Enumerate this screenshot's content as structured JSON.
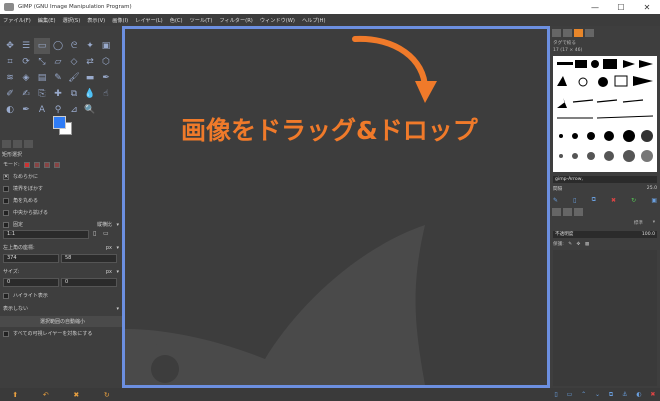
{
  "window": {
    "title": "GIMP (GNU Image Manipulation Program)",
    "minimize": "—",
    "maximize": "☐",
    "close": "✕"
  },
  "menu": [
    "ファイル(F)",
    "編集(E)",
    "選択(S)",
    "表示(V)",
    "画像(I)",
    "レイヤー(L)",
    "色(C)",
    "ツール(T)",
    "フィルター(R)",
    "ウィンドウ(W)",
    "ヘルプ(H)"
  ],
  "tool_options": {
    "title": "矩形選択",
    "mode_label": "モード:",
    "antialias": "なめらかに",
    "feather": "境界をぼかす",
    "rounded": "角を丸める",
    "expand_center": "中央から拡げる",
    "fixed_label": "固定",
    "fixed_value": "縦横比",
    "ratio_value": "1:1",
    "position_label": "左上角の座標:",
    "position_unit": "px",
    "pos_x": "374",
    "pos_y": "58",
    "size_label": "サイズ:",
    "size_unit": "px",
    "size_w": "0",
    "size_h": "0",
    "highlight": "ハイライト表示",
    "guides_value": "表示しない",
    "shrink_button": "選択範囲の自動縮小",
    "merged": "すべての可視レイヤーを対象にする"
  },
  "canvas": {
    "headline": "画像をドラッグ&ドロップ",
    "arrow_color": "#f07a2a",
    "border_color": "#6c8fe0"
  },
  "brushes": {
    "filter_label": "タグで絞る",
    "subtitle": "17 (17 × 46)",
    "selected_name": "gimp-Arrow,",
    "spacing_label": "間隔",
    "spacing_value": "25.0"
  },
  "layers": {
    "mode_label": "標準",
    "opacity_label": "不透明度",
    "opacity_value": "100.0",
    "lock_label": "保護:"
  }
}
